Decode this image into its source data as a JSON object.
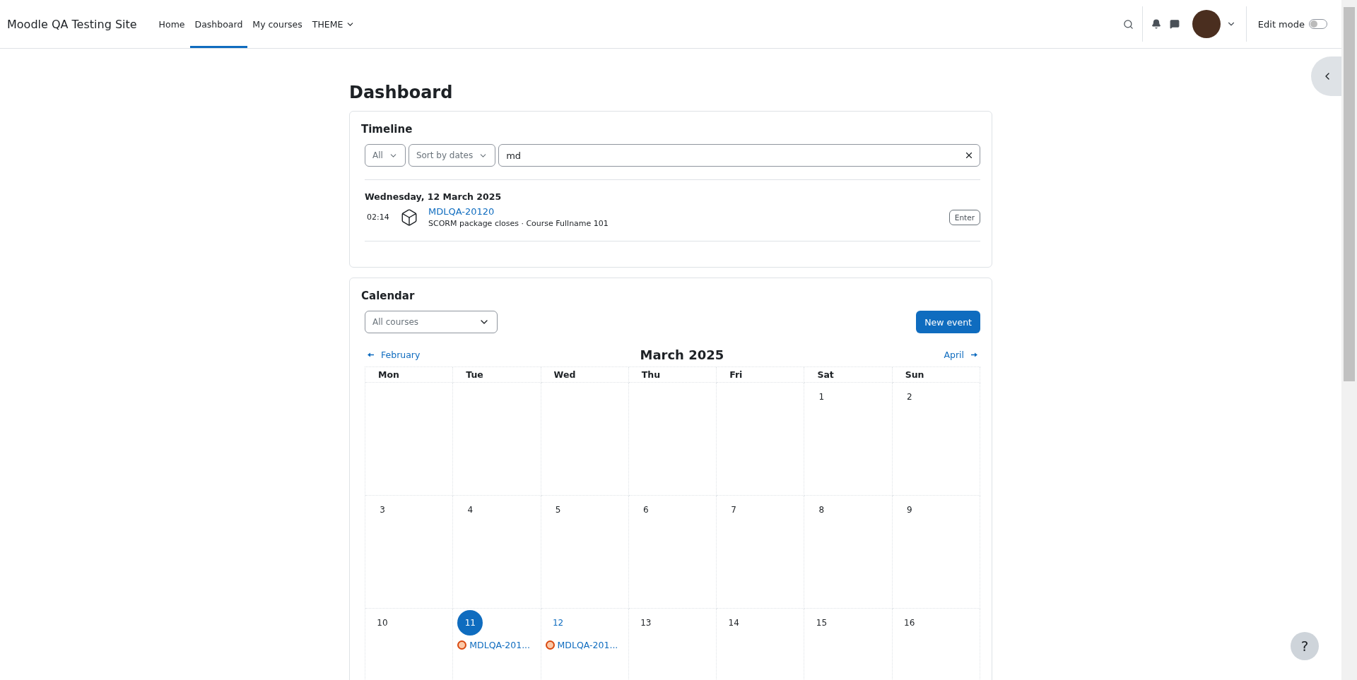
{
  "site_name": "Moodle QA Testing Site",
  "nav": [
    {
      "label": "Home",
      "selected": false,
      "dropdown": false
    },
    {
      "label": "Dashboard",
      "selected": true,
      "dropdown": false
    },
    {
      "label": "My courses",
      "selected": false,
      "dropdown": false
    },
    {
      "label": "THEME",
      "selected": false,
      "dropdown": true
    }
  ],
  "edit_mode": {
    "label": "Edit mode",
    "on": false
  },
  "page_title": "Dashboard",
  "timeline": {
    "title": "Timeline",
    "filter": "All",
    "sort": "Sort by dates",
    "search": {
      "value": "md"
    },
    "groups": [
      {
        "date": "Wednesday, 12 March 2025",
        "events": [
          {
            "time": "02:14",
            "name": "MDLQA-20120",
            "detail": "SCORM package closes · Course Fullname 101",
            "action": "Enter"
          }
        ]
      }
    ]
  },
  "calendar": {
    "title": "Calendar",
    "course_filter": "All courses",
    "new_event": "New event",
    "prev": "February",
    "next": "April",
    "month": "March 2025",
    "weekdays": [
      "Mon",
      "Tue",
      "Wed",
      "Thu",
      "Fri",
      "Sat",
      "Sun"
    ],
    "weeks": [
      [
        {
          "day": "1",
          "today": false
        },
        {
          "day": "2",
          "today": false
        }
      ],
      [
        {
          "day": "3",
          "today": false
        },
        {
          "day": "4",
          "today": false
        },
        {
          "day": "5",
          "today": false
        },
        {
          "day": "6",
          "today": false
        },
        {
          "day": "7",
          "today": false
        },
        {
          "day": "8",
          "today": false
        },
        {
          "day": "9",
          "today": false
        }
      ],
      [
        {
          "day": "10",
          "today": false
        },
        {
          "day": "11",
          "today": true,
          "events": [
            "MDLQA-201..."
          ]
        },
        {
          "day": "12",
          "today": false,
          "events": [
            "MDLQA-201..."
          ]
        },
        {
          "day": "13",
          "today": false
        },
        {
          "day": "14",
          "today": false
        },
        {
          "day": "15",
          "today": false
        },
        {
          "day": "16",
          "today": false
        }
      ]
    ]
  },
  "help": "?"
}
